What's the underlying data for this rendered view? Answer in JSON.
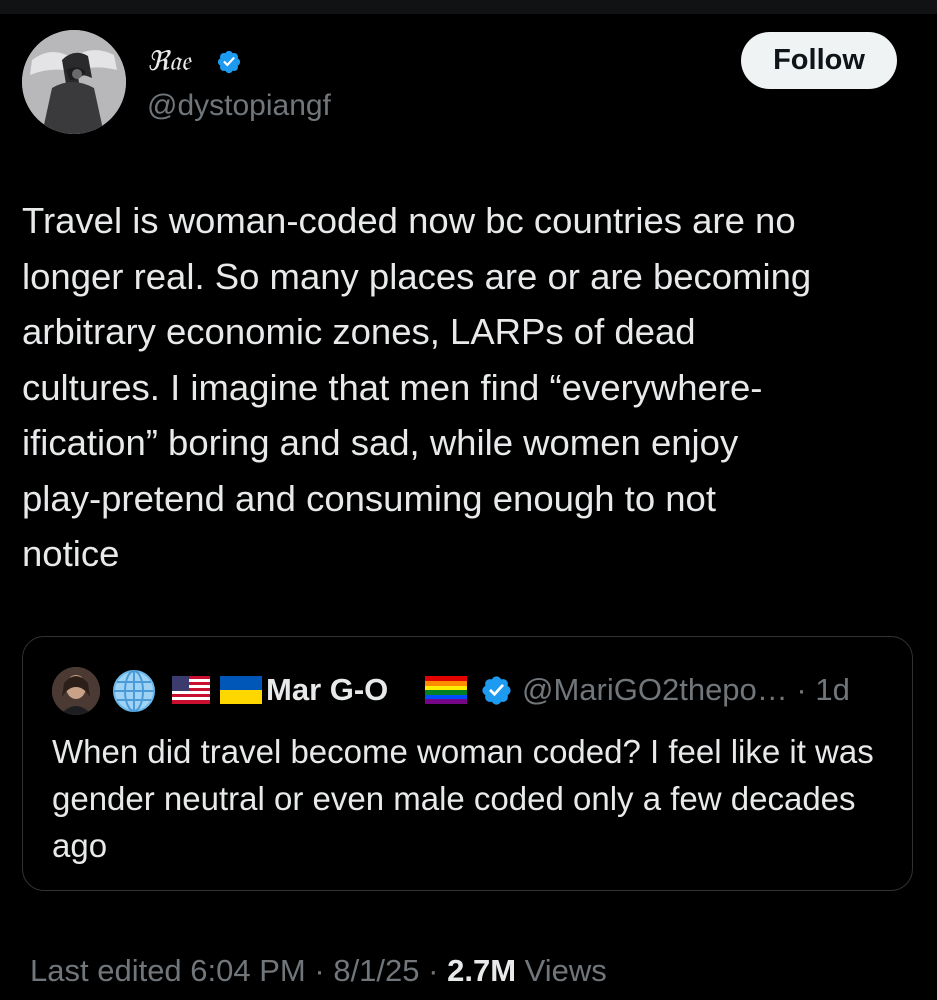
{
  "author": {
    "name": "ℜ𝔞𝔢",
    "handle": "@dystopiangf",
    "verified": true
  },
  "follow_button": {
    "label": "Follow"
  },
  "tweet": {
    "text": "Travel is woman-coded now bc countries are no\nlonger real. So many places are or are becoming\narbitrary economic zones, LARPs of dead\ncultures. I imagine that men find “everywhere-\nification” boring and sad, while women enjoy\nplay-pretend and consuming enough to not\nnotice"
  },
  "quoted_tweet": {
    "author_name": "Mar G-O",
    "handle": "@MariGO2thepo…",
    "separator": "·",
    "time": "1d",
    "verified": true,
    "name_emojis": [
      "globe-icon",
      "us-flag-icon",
      "ukraine-flag-icon"
    ],
    "trailing_emoji": "pride-flag-icon",
    "text": "When did travel become woman coded? I feel like it was gender neutral or even male coded only a few decades ago"
  },
  "footer": {
    "edited_label": "Last edited",
    "time": "6:04 PM",
    "date": "8/1/25",
    "separator": "·",
    "views_count": "2.7M",
    "views_label": "Views"
  },
  "colors": {
    "background": "#000000",
    "text_primary": "#e7e9ea",
    "text_secondary": "#71767b",
    "verified_blue": "#1d9bf0",
    "border": "#2f3336",
    "follow_bg": "#eff3f4"
  }
}
